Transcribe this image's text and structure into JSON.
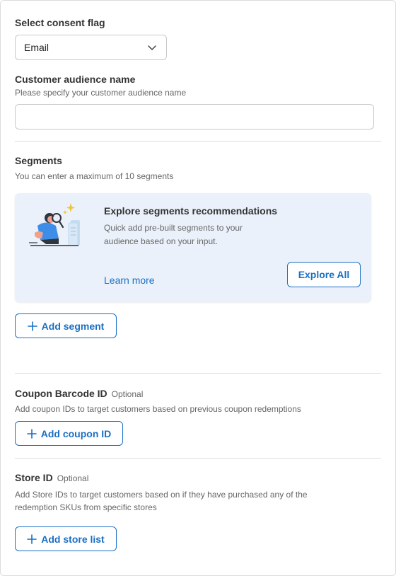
{
  "consent": {
    "label": "Select consent flag",
    "selected": "Email"
  },
  "audience": {
    "label": "Customer audience name",
    "hint": "Please specify your customer audience name",
    "value": "",
    "placeholder": ""
  },
  "segments": {
    "label": "Segments",
    "hint": "You can enter a maximum of 10 segments",
    "card": {
      "title": "Explore segments recommendations",
      "description": "Quick add pre-built segments to your audience based on your input.",
      "learn_more": "Learn more",
      "explore_button": "Explore All"
    },
    "add_button": "Add segment"
  },
  "coupon": {
    "label": "Coupon Barcode ID",
    "optional": "Optional",
    "hint": "Add coupon IDs to target customers based on previous coupon redemptions",
    "add_button": "Add coupon ID"
  },
  "store": {
    "label": "Store ID",
    "optional": "Optional",
    "hint": "Add Store IDs to target customers based on if they have purchased any of the redemption SKUs from specific stores",
    "add_button": "Add store list"
  },
  "colors": {
    "accent": "#1a6fc4",
    "card_background": "#eaf1fa",
    "divider": "#dedede"
  },
  "icons": [
    "chevron-down-icon",
    "plus-icon",
    "illustration-person-magnifier"
  ]
}
